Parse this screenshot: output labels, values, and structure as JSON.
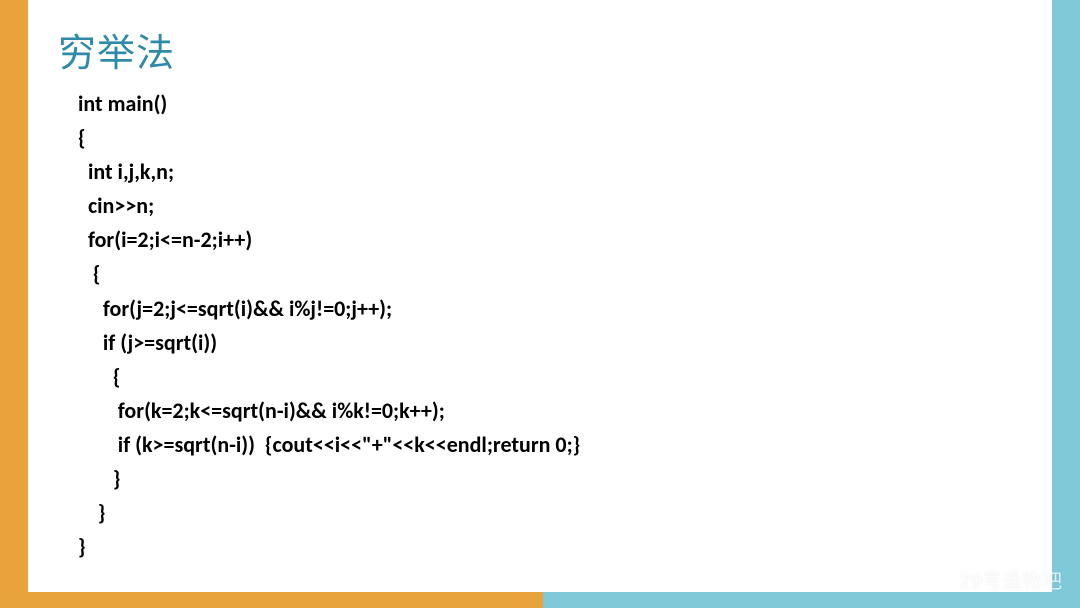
{
  "title": "穷举法",
  "code_lines": [
    "int main()",
    "{",
    "  int i,j,k,n;",
    "  cin>>n;",
    "  for(i=2;i<=n-2;i++)",
    "   {",
    "     for(j=2;j<=sqrt(i)&& i%j!=0;j++);",
    "     if (j>=sqrt(i))",
    "       {",
    "        for(k=2;k<=sqrt(n-i)&& i%k!=0;k++);",
    "        if (k>=sqrt(n-i))  {cout<<i<<\"+\"<<k<<endl;return 0;}",
    "       }",
    "    }",
    "}"
  ],
  "watermark": {
    "text": "29号造物吧",
    "icon": "wechat-icon"
  },
  "colors": {
    "left_bg": "#e8a33d",
    "right_bg": "#7fc9d8",
    "title": "#2e8aa8",
    "card": "#ffffff"
  }
}
